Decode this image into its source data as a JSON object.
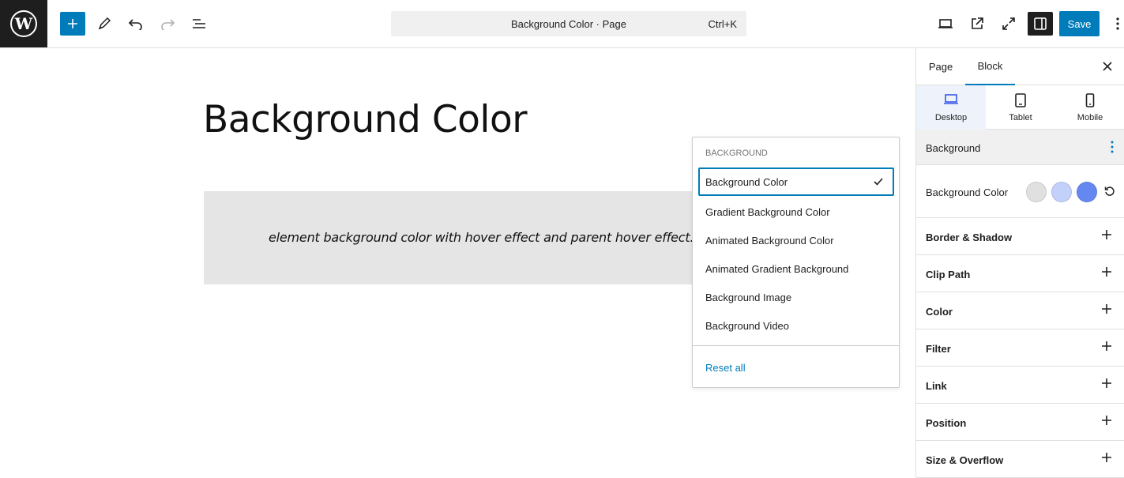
{
  "toolbar": {
    "command_title": "Background Color · Page",
    "command_shortcut": "Ctrl+K",
    "save_label": "Save"
  },
  "canvas": {
    "page_title": "Background Color",
    "group_text": "element background color with hover effect and parent hover effect."
  },
  "dropdown": {
    "heading": "BACKGROUND",
    "items": [
      {
        "label": "Background Color",
        "selected": true
      },
      {
        "label": "Gradient Background Color",
        "selected": false
      },
      {
        "label": "Animated Background Color",
        "selected": false
      },
      {
        "label": "Animated Gradient Background",
        "selected": false
      },
      {
        "label": "Background Image",
        "selected": false
      },
      {
        "label": "Background Video",
        "selected": false
      }
    ],
    "reset_label": "Reset all"
  },
  "panel": {
    "tabs": [
      {
        "label": "Page",
        "active": false
      },
      {
        "label": "Block",
        "active": true
      }
    ],
    "devices": [
      {
        "label": "Desktop",
        "icon": "desktop-icon",
        "active": true
      },
      {
        "label": "Tablet",
        "icon": "tablet-icon",
        "active": false
      },
      {
        "label": "Mobile",
        "icon": "mobile-icon",
        "active": false
      }
    ],
    "background_header": "Background",
    "background_color_label": "Background Color",
    "swatches": [
      "#e0e0e0",
      "#c3d0fa",
      "#6488f0"
    ],
    "sections": [
      "Border & Shadow",
      "Clip Path",
      "Color",
      "Filter",
      "Link",
      "Position",
      "Size & Overflow"
    ]
  },
  "colors": {
    "accent": "#007cba",
    "dark": "#1e1e1e"
  }
}
